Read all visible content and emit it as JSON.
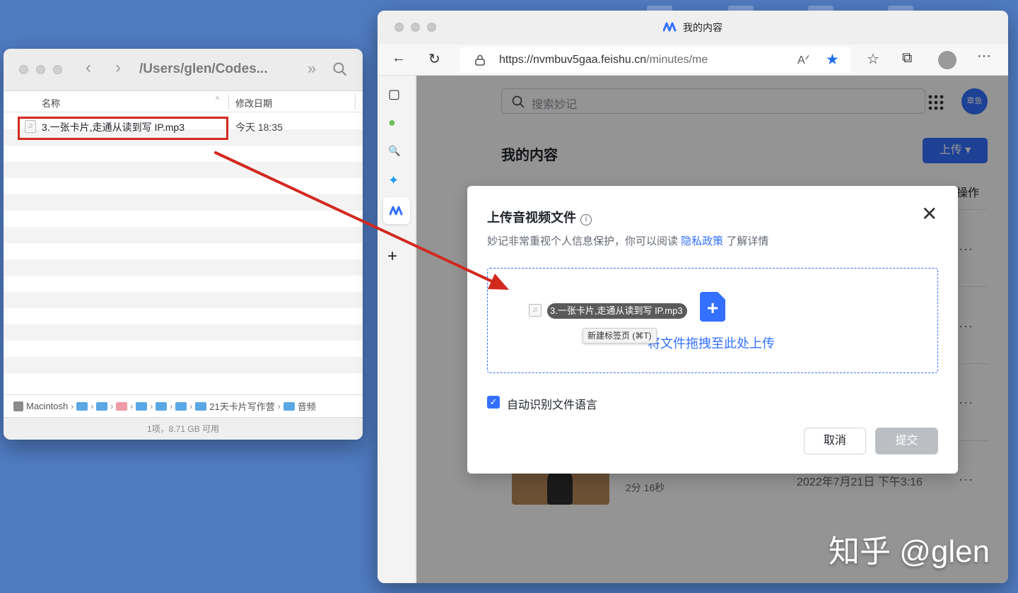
{
  "finder": {
    "path_title": "/Users/glen/Codes...",
    "col_name": "名称",
    "col_modified": "修改日期",
    "file_name": "3.一张卡片,走通从读到写 IP.mp3",
    "file_date": "今天 18:35",
    "path_root": "Macintosh",
    "path_folder_1": "21天卡片写作营",
    "path_folder_2": "音频",
    "status": "1项，8.71 GB 可用",
    "nav_more": "»"
  },
  "browser": {
    "tab_title": "我的内容",
    "url_host": "https://nvmbuv5gaa.feishu.cn",
    "url_path": "/minutes/me",
    "search_placeholder": "搜索妙记",
    "page_heading": "我的内容",
    "upload_button": "上传 ▾",
    "avatar_text": "章鱼",
    "col_action": "操作",
    "row_duration": "2分 16秒",
    "row_date": "2022年7月21日 下午3:16",
    "more": "···"
  },
  "dialog": {
    "title": "上传音视频文件",
    "info": "i",
    "desc_prefix": "妙记非常重视个人信息保护，你可以阅读 ",
    "desc_link": "隐私政策",
    "desc_suffix": " 了解详情",
    "drop_text": "将文件拖拽至此处上传",
    "drag_chip": "3.一张卡片,走通从读到写 IP.mp3",
    "tooltip": "新建标签页 (⌘T)",
    "checkbox_label": "自动识别文件语言",
    "cancel": "取消",
    "submit": "提交"
  },
  "watermark": "知乎 @glen",
  "colors": {
    "desktop": "#4f7bc0",
    "accent": "#3370ff",
    "highlight_red": "#d2291f"
  }
}
